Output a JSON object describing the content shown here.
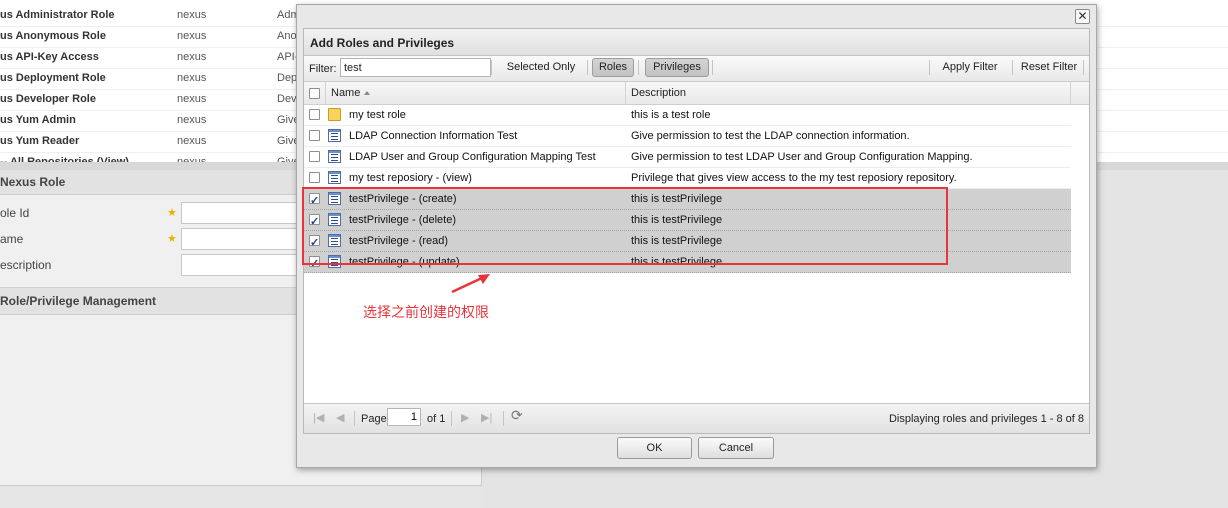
{
  "background": {
    "roles": [
      {
        "name": "us Administrator Role",
        "source": "nexus",
        "desc": "Adm"
      },
      {
        "name": "us Anonymous Role",
        "source": "nexus",
        "desc": "Ano"
      },
      {
        "name": "us API-Key Access",
        "source": "nexus",
        "desc": "API-"
      },
      {
        "name": "us Deployment Role",
        "source": "nexus",
        "desc": "Dep"
      },
      {
        "name": "us Developer Role",
        "source": "nexus",
        "desc": "Dev"
      },
      {
        "name": "us Yum Admin",
        "source": "nexus",
        "desc": "Give"
      },
      {
        "name": "us Yum Reader",
        "source": "nexus",
        "desc": "Give"
      },
      {
        "name": "-- All Repositories (View)",
        "source": "nexus",
        "desc": "Give"
      }
    ],
    "panel_title": "Nexus Role",
    "fields": [
      {
        "label": "ole Id",
        "required": true
      },
      {
        "label": "ame",
        "required": true
      },
      {
        "label": "escription",
        "required": false
      }
    ],
    "section_title": "Role/Privilege Management"
  },
  "dialog": {
    "close_glyph": "✕",
    "title": "Add Roles and Privileges",
    "toolbar": {
      "filter_label": "Filter:",
      "filter_value": "test",
      "selected_only": "Selected Only",
      "roles": "Roles",
      "privileges": "Privileges",
      "apply_filter": "Apply Filter",
      "reset_filter": "Reset Filter"
    },
    "columns": {
      "name": "Name",
      "description": "Description"
    },
    "rows": [
      {
        "name": "my test role",
        "description": "this is a test role",
        "icon": "folder-icon",
        "checked": false
      },
      {
        "name": "LDAP Connection Information Test",
        "description": "Give permission to test the LDAP connection information.",
        "icon": "privilege-icon",
        "checked": false
      },
      {
        "name": "LDAP User and Group Configuration Mapping Test",
        "description": "Give permission to test LDAP User and Group Configuration Mapping.",
        "icon": "privilege-icon",
        "checked": false
      },
      {
        "name": "my test reposiory - (view)",
        "description": "Privilege that gives view access to the my test reposiory repository.",
        "icon": "privilege-icon",
        "checked": false
      },
      {
        "name": "testPrivilege - (create)",
        "description": "this is testPrivilege",
        "icon": "privilege-icon",
        "checked": true
      },
      {
        "name": "testPrivilege - (delete)",
        "description": "this is testPrivilege",
        "icon": "privilege-icon",
        "checked": true
      },
      {
        "name": "testPrivilege - (read)",
        "description": "this is testPrivilege",
        "icon": "privilege-icon",
        "checked": true
      },
      {
        "name": "testPrivilege - (update)",
        "description": "this is testPrivilege",
        "icon": "privilege-icon",
        "checked": true
      }
    ],
    "pager": {
      "page_label": "Page",
      "page_value": "1",
      "of_label": "of 1",
      "info": "Displaying roles and privileges 1 - 8 of 8"
    },
    "ok": "OK",
    "cancel": "Cancel"
  },
  "annotation": {
    "text": "选择之前创建的权限",
    "color": "#e8343a"
  }
}
